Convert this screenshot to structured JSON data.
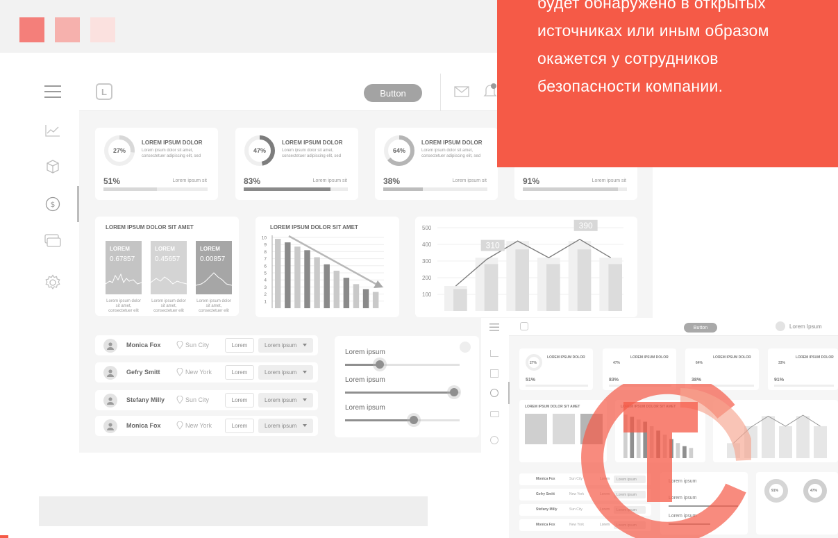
{
  "overlay_text": "будет обнаружено в открытых\nисточниках или иным образом\nокажется у сотрудников\nбезопасности компании.",
  "colors": {
    "accent_red": "#f55a47",
    "sq1": "#f47f7a",
    "sq2": "#f6b1ad",
    "sq3": "#fbe1df"
  },
  "toolbar": {
    "button_label": "Button",
    "icons": [
      "menu-icon",
      "mail-icon",
      "bell-icon"
    ]
  },
  "sidebar": {
    "icons": [
      "chart-line-icon",
      "cube-icon",
      "dollar-icon",
      "cards-icon",
      "gear-icon"
    ]
  },
  "stats": [
    {
      "ring": "27%",
      "title": "LOREM IPSUM DOLOR",
      "desc": "Lorem ipsum dolor sit amet, consectetuer adipiscing elit, sed",
      "pct": "51%",
      "label": "Lorem ipsum sit",
      "ring_value": 0.27,
      "bar_value": 0.51
    },
    {
      "ring": "47%",
      "title": "LOREM IPSUM DOLOR",
      "desc": "Lorem ipsum dolor sit amet, consectetuer adipiscing elit, sed",
      "pct": "83%",
      "label": "Lorem ipsum sit",
      "ring_value": 0.47,
      "bar_value": 0.83
    },
    {
      "ring": "64%",
      "title": "LOREM IPSUM DOLOR",
      "desc": "Lorem ipsum dolor sit amet, consectetuer adipiscing elit, sed",
      "pct": "38%",
      "label": "Lorem ipsum sit",
      "ring_value": 0.64,
      "bar_value": 0.38
    },
    {
      "pct": "91%",
      "label": "Lorem ipsum sit",
      "bar_value": 0.91
    }
  ],
  "widget1": {
    "title": "LOREM IPSUM DOLOR SIT AMET",
    "cards": [
      {
        "label": "LOREM",
        "value": "0.67857",
        "desc": "Lorem ipsum dolor sit amet, consectetuer elit"
      },
      {
        "label": "LOREM",
        "value": "0.45657",
        "desc": "Lorem ipsum dolor sit amet, consectetuer elit"
      },
      {
        "label": "LOREM",
        "value": "0.00857",
        "desc": "Lorem ipsum dolor sit amet, consectetuer elit"
      }
    ]
  },
  "chart_data": [
    {
      "type": "bar",
      "title": "LOREM IPSUM DOLOR SIT AMET",
      "ylim": [
        0,
        10
      ],
      "y_ticks": [
        "1",
        "2",
        "3",
        "4",
        "5",
        "6",
        "7",
        "8",
        "9",
        "10"
      ],
      "values": [
        9.8,
        9.3,
        8.7,
        8.2,
        7.2,
        6.2,
        5.3,
        4.3,
        3.4,
        2.7,
        2.3
      ],
      "grid": true,
      "annotations": [
        "downward trend arrow"
      ]
    },
    {
      "type": "bar",
      "title": "",
      "ylim": [
        0,
        500
      ],
      "y_ticks": [
        "100",
        "200",
        "300",
        "400",
        "500"
      ],
      "values": [
        150,
        320,
        420,
        320,
        420,
        320
      ],
      "line": [
        150,
        310,
        420,
        320,
        430,
        320
      ],
      "labels": [
        {
          "index": 1,
          "text": "310"
        },
        {
          "index": 4,
          "text": "390"
        }
      ],
      "grid": true
    }
  ],
  "people": [
    {
      "name": "Monica Fox",
      "city": "Sun City",
      "action": "Lorem",
      "select": "Lorem ipsum"
    },
    {
      "name": "Gefry Smitt",
      "city": "New York",
      "action": "Lorem",
      "select": "Lorem ipsum"
    },
    {
      "name": "Stefany Milly",
      "city": "Sun City",
      "action": "Lorem",
      "select": "Lorem ipsum"
    },
    {
      "name": "Monica Fox",
      "city": "New York",
      "action": "Lorem",
      "select": "Lorem ipsum"
    }
  ],
  "sliders": [
    {
      "label": "Lorem ipsum",
      "value": 0.3
    },
    {
      "label": "Lorem ipsum",
      "value": 0.95
    },
    {
      "label": "Lorem ipsum",
      "value": 0.6
    }
  ],
  "preview": {
    "button_label": "Button",
    "user_label": "Lorem Ipsum",
    "stat_title": "LOREM IPSUM DOLOR",
    "pcts": [
      "51%",
      "83%",
      "38%",
      "91%"
    ],
    "rings": [
      "27%",
      "47%",
      "64%",
      "33%"
    ],
    "widget_title": "LOREM IPSUM DOLOR SIT AMET",
    "people": [
      "Monica Fox",
      "Gefry Smitt",
      "Stefany Milly",
      "Monica Fox"
    ],
    "cities": [
      "Sun City",
      "New York",
      "Sun City",
      "New York"
    ],
    "action": "Lorem",
    "select": "Lorem ipsum",
    "slider_label": "Lorem ipsum",
    "donuts": [
      "91%",
      "47%"
    ]
  }
}
